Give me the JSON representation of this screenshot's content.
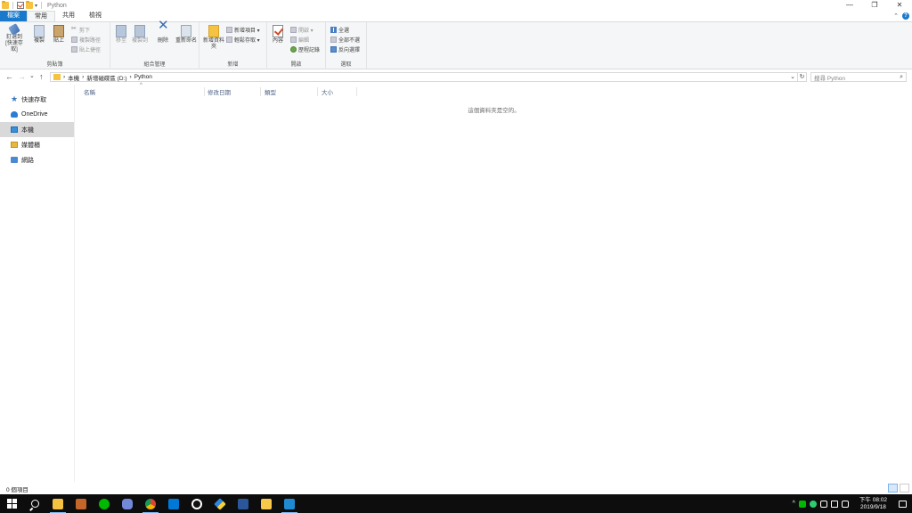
{
  "window": {
    "title": "Python",
    "controls": {
      "minimize": "—",
      "maximize": "❐",
      "close": "✕"
    }
  },
  "tabs": [
    {
      "label": "檔案"
    },
    {
      "label": "常用"
    },
    {
      "label": "共用"
    },
    {
      "label": "檢視"
    }
  ],
  "ribbon": {
    "clipboard": {
      "label": "剪貼簿",
      "pin": "釘選到 [快速存取]",
      "copy": "複製",
      "paste": "貼上",
      "cut": "剪下",
      "copy_path": "複製路徑",
      "paste_shortcut": "貼上捷徑"
    },
    "organize": {
      "label": "組合管理",
      "move_to": "移至",
      "copy_to": "複製到",
      "delete": "刪除",
      "rename": "重新命名"
    },
    "new": {
      "label": "新增",
      "new_folder": "新增資料夾",
      "new_item": "新增項目 ▾",
      "easy_access": "輕鬆存取 ▾"
    },
    "open": {
      "label": "開啟",
      "properties": "內容",
      "open": "開啟 ▾",
      "edit": "編輯",
      "history": "歷程記錄"
    },
    "select": {
      "label": "選取",
      "select_all": "全選",
      "select_none": "全部不選",
      "invert": "反向選擇"
    }
  },
  "address": {
    "back": "←",
    "forward": "→",
    "recent": "⌄",
    "up": "↑",
    "path": [
      "本機",
      "新增磁碟區 (D:)",
      "Python"
    ],
    "separator": "›",
    "dropdown": "⌄",
    "refresh": "↻",
    "search_placeholder": "搜尋 Python",
    "search_icon": "⌕"
  },
  "nav": {
    "items": [
      {
        "label": "快速存取",
        "icon": "star-icon"
      },
      {
        "label": "OneDrive",
        "icon": "cloud-icon"
      },
      {
        "label": "本機",
        "icon": "pc-icon",
        "selected": true
      },
      {
        "label": "媒體櫃",
        "icon": "library-icon"
      },
      {
        "label": "網路",
        "icon": "network-icon"
      }
    ]
  },
  "columns": [
    {
      "label": "名稱"
    },
    {
      "label": "修改日期"
    },
    {
      "label": "類型"
    },
    {
      "label": "大小"
    }
  ],
  "sort_indicator": "^",
  "empty_message": "這個資料夾是空的。",
  "status": {
    "items_count": "0 個項目"
  },
  "taskbar": {
    "apps": [
      "windows-start",
      "search",
      "file-explorer",
      "media-player",
      "line",
      "discord",
      "chrome",
      "mail",
      "target-app",
      "git-app",
      "word",
      "sticky-notes",
      "vscode"
    ],
    "tray_chevron": "^",
    "clock_time": "下午 08:02",
    "clock_date": "2019/9/18"
  }
}
